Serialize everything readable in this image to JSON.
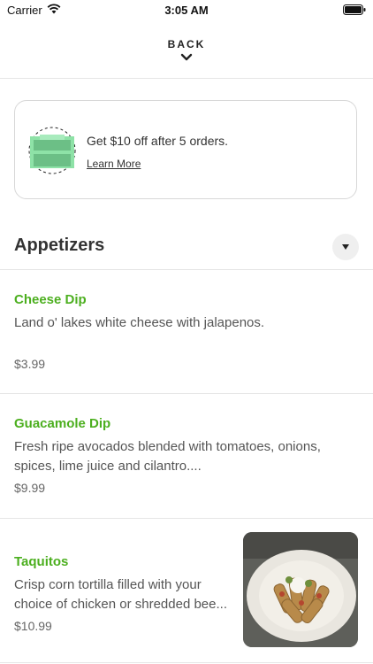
{
  "status_bar": {
    "carrier": "Carrier",
    "time": "3:05 AM"
  },
  "header": {
    "back_label": "BACK"
  },
  "promo": {
    "headline": "Get $10 off after 5 orders.",
    "link": "Learn More",
    "accent_color": "#8ee2a7"
  },
  "section": {
    "title": "Appetizers"
  },
  "items": [
    {
      "name": "Cheese Dip",
      "description": "Land o' lakes white cheese with jalapenos.",
      "price": "$3.99"
    },
    {
      "name": "Guacamole Dip",
      "description": "Fresh ripe avocados blended with tomatoes, onions, spices, lime juice and cilantro....",
      "price": "$9.99"
    },
    {
      "name": "Taquitos",
      "description": "Crisp corn tortilla filled with your choice of chicken or shredded bee...",
      "price": "$10.99"
    }
  ],
  "colors": {
    "item_name": "#4caf1f",
    "divider": "#e6e6e6"
  }
}
